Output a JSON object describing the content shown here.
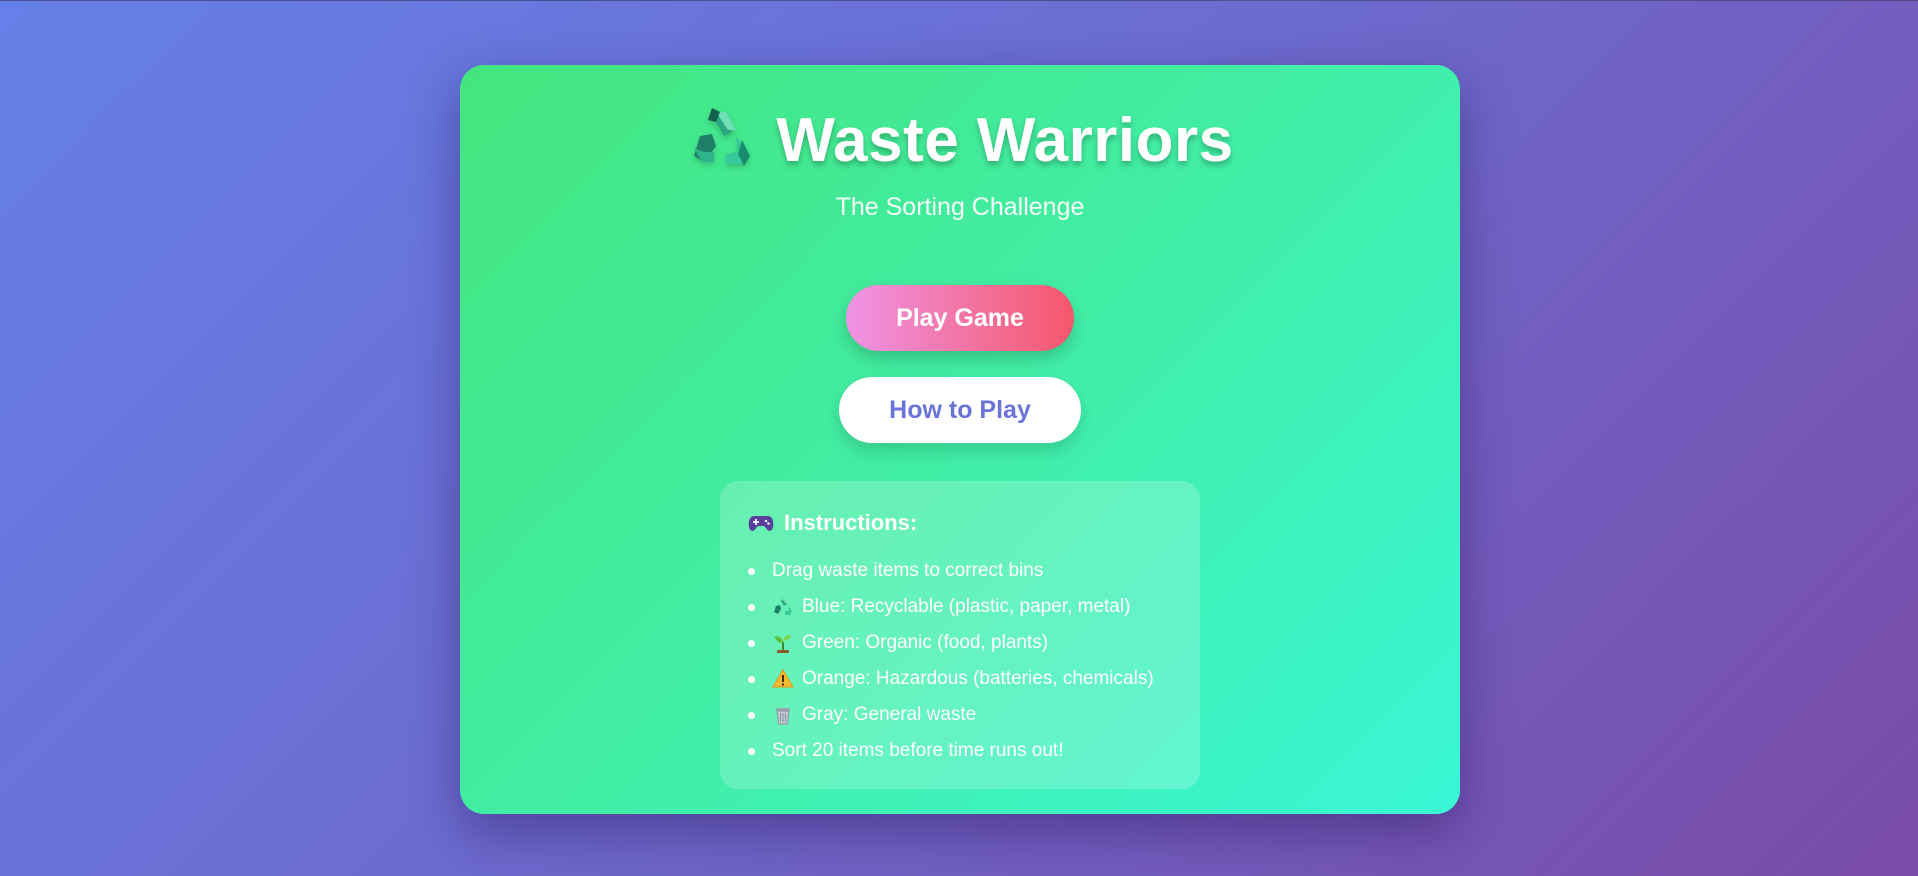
{
  "game": {
    "title": "Waste Warriors",
    "subtitle": "The Sorting Challenge",
    "title_icon": "recycle-icon"
  },
  "menu": {
    "play_label": "Play Game",
    "how_label": "How to Play"
  },
  "instructions": {
    "heading": "Instructions:",
    "heading_icon": "gamepad-icon",
    "items": [
      {
        "icon": "",
        "text": "Drag waste items to correct bins"
      },
      {
        "icon": "recycle-icon",
        "text": "Blue: Recyclable (plastic, paper, metal)"
      },
      {
        "icon": "seedling-icon",
        "text": "Green: Organic (food, plants)"
      },
      {
        "icon": "warning-icon",
        "text": "Orange: Hazardous (batteries, chemicals)"
      },
      {
        "icon": "trash-bin-icon",
        "text": "Gray: General waste"
      },
      {
        "icon": "",
        "text": "Sort 20 items before time runs out!"
      }
    ]
  },
  "colors": {
    "background_start": "#6580e8",
    "background_end": "#7a4ba8",
    "card_start": "#44e57e",
    "card_end": "#3af6d6",
    "play_button_start": "#f093e6",
    "play_button_end": "#f6566c",
    "how_button_text": "#6a73d8"
  }
}
